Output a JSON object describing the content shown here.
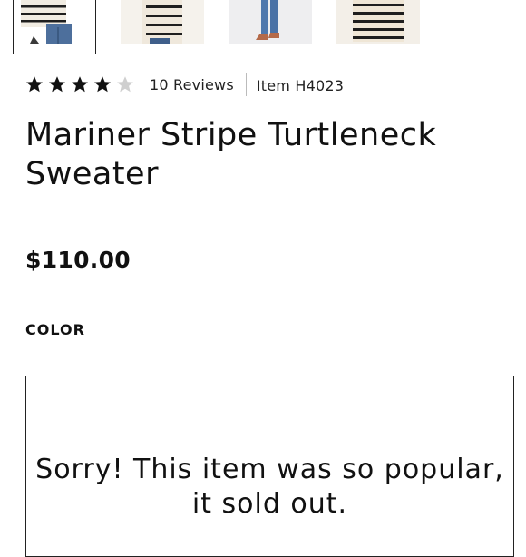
{
  "gallery": {
    "thumbnails": [
      {
        "alt": "product-photo-1-thumbnail",
        "selected": true
      },
      {
        "alt": "product-photo-2-thumbnail",
        "selected": false
      },
      {
        "alt": "product-photo-3-thumbnail",
        "selected": false
      },
      {
        "alt": "product-photo-4-thumbnail",
        "selected": false
      }
    ]
  },
  "rating": {
    "stars_filled": 4,
    "stars_total": 5,
    "reviews_label": "10 Reviews",
    "star_color": "#111111",
    "star_empty_color": "#cfcfcf"
  },
  "item_label": "Item H4023",
  "product": {
    "title": "Mariner Stripe Turtleneck Sweater",
    "price": "$110.00"
  },
  "color_section": {
    "label": "COLOR"
  },
  "sold_out": {
    "message": "Sorry! This item was so popular, it sold out."
  }
}
